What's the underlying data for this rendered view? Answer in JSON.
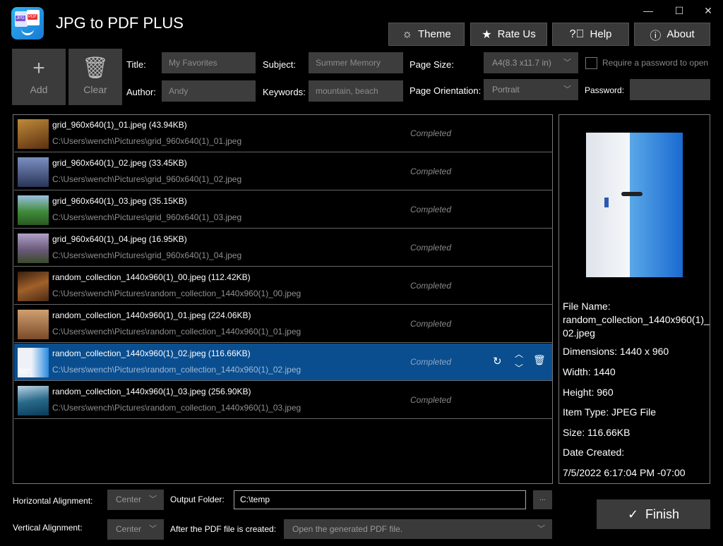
{
  "app": {
    "title": "JPG to PDF PLUS",
    "icon_left_text": "JPG",
    "icon_right_text": "PDF"
  },
  "window": {
    "minimize": "—",
    "maximize": "☐",
    "close": "✕"
  },
  "toolbar": {
    "theme": "Theme",
    "rate": "Rate Us",
    "help": "Help",
    "about": "About"
  },
  "actions": {
    "add": "Add",
    "clear": "Clear"
  },
  "meta": {
    "title_label": "Title:",
    "title_value": "My Favorites",
    "author_label": "Author:",
    "author_value": "Andy",
    "subject_label": "Subject:",
    "subject_value": "Summer Memory",
    "keywords_label": "Keywords:",
    "keywords_value": "mountain, beach",
    "page_size_label": "Page Size:",
    "page_size_value": "A4(8.3 x11.7 in)",
    "orientation_label": "Page Orientation:",
    "orientation_value": "Portrait",
    "require_password_label": "Require a password to open",
    "password_label": "Password:",
    "password_value": ""
  },
  "files": [
    {
      "name": "grid_960x640(1)_01.jpeg (43.94KB)",
      "path": "C:\\Users\\wench\\Pictures\\grid_960x640(1)_01.jpeg",
      "status": "Completed",
      "thumb": "#8a5a22"
    },
    {
      "name": "grid_960x640(1)_02.jpeg (33.45KB)",
      "path": "C:\\Users\\wench\\Pictures\\grid_960x640(1)_02.jpeg",
      "status": "Completed",
      "thumb": "#3b4f7a"
    },
    {
      "name": "grid_960x640(1)_03.jpeg (35.15KB)",
      "path": "C:\\Users\\wench\\Pictures\\grid_960x640(1)_03.jpeg",
      "status": "Completed",
      "thumb": "#3f7a3a"
    },
    {
      "name": "grid_960x640(1)_04.jpeg (16.95KB)",
      "path": "C:\\Users\\wench\\Pictures\\grid_960x640(1)_04.jpeg",
      "status": "Completed",
      "thumb": "#6a5a7a"
    },
    {
      "name": "random_collection_1440x960(1)_00.jpeg (112.42KB)",
      "path": "C:\\Users\\wench\\Pictures\\random_collection_1440x960(1)_00.jpeg",
      "status": "Completed",
      "thumb": "#5a3a22"
    },
    {
      "name": "random_collection_1440x960(1)_01.jpeg (224.06KB)",
      "path": "C:\\Users\\wench\\Pictures\\random_collection_1440x960(1)_01.jpeg",
      "status": "Completed",
      "thumb": "#7a5a3a"
    },
    {
      "name": "random_collection_1440x960(1)_02.jpeg (116.66KB)",
      "path": "C:\\Users\\wench\\Pictures\\random_collection_1440x960(1)_02.jpeg",
      "status": "Completed",
      "thumb": "#dfe7f2",
      "rotation": "90°"
    },
    {
      "name": "random_collection_1440x960(1)_03.jpeg (256.90KB)",
      "path": "C:\\Users\\wench\\Pictures\\random_collection_1440x960(1)_03.jpeg",
      "status": "Completed",
      "thumb": "#2a6a8a"
    }
  ],
  "preview": {
    "file_name_label": "File Name:",
    "file_name_line1": "random_collection_1440x960(1)_",
    "file_name_line2": "02.jpeg",
    "dimensions": "Dimensions: 1440 x 960",
    "width": "Width: 1440",
    "height": "Height: 960",
    "item_type": "Item Type: JPEG File",
    "size": "Size: 116.66KB",
    "date_created_label": "Date Created:",
    "date_created": "7/5/2022 6:17:04 PM -07:00"
  },
  "bottom": {
    "h_align_label": "Horizontal Alignment:",
    "h_align_value": "Center",
    "v_align_label": "Vertical Alignment:",
    "v_align_value": "Center",
    "output_label": "Output Folder:",
    "output_value": "C:\\temp",
    "browse": "...",
    "after_label": "After the PDF file is created:",
    "after_value": "Open the generated PDF file.",
    "finish": "Finish"
  }
}
